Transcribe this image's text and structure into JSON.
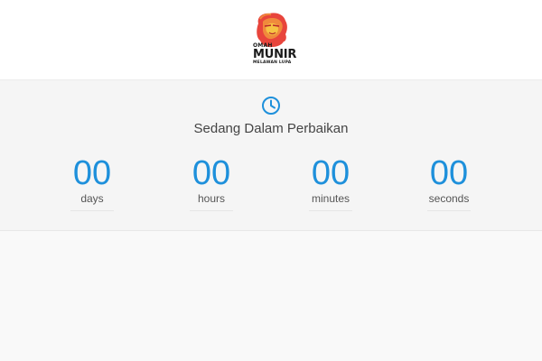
{
  "logo": {
    "line1": "OMAH",
    "line2": "MUNIR",
    "line3": "MELAWAN LUPA"
  },
  "main": {
    "clock_icon": "clock-icon",
    "heading": "Sedang Dalam Perbaikan",
    "countdown": [
      {
        "value": "00",
        "label": "days"
      },
      {
        "value": "00",
        "label": "hours"
      },
      {
        "value": "00",
        "label": "minutes"
      },
      {
        "value": "00",
        "label": "seconds"
      }
    ]
  },
  "colors": {
    "accent": "#1e90db",
    "background": "#f5f5f5",
    "header_background": "#ffffff"
  }
}
